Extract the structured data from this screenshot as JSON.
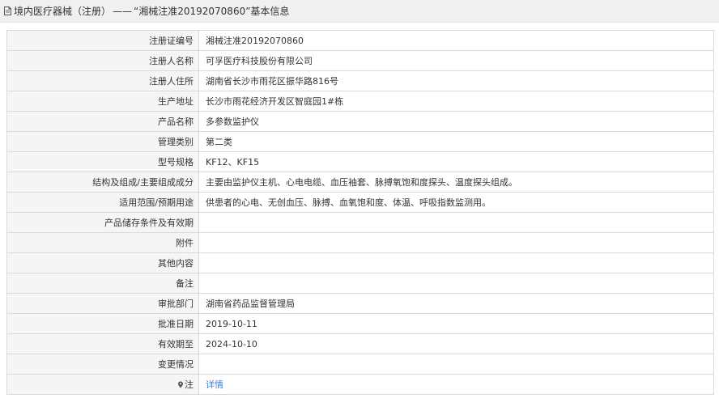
{
  "header": {
    "icon": "document-icon",
    "prefix": "境内医疗器械（注册）",
    "separator": "——",
    "title": "“湘械注准20192070860”基本信息"
  },
  "rows": [
    {
      "label": "注册证编号",
      "value": "湘械注准20192070860"
    },
    {
      "label": "注册人名称",
      "value": "可孚医疗科技股份有限公司"
    },
    {
      "label": "注册人住所",
      "value": "湖南省长沙市雨花区振华路816号"
    },
    {
      "label": "生产地址",
      "value": "长沙市雨花经济开发区智庭园1#栋"
    },
    {
      "label": "产品名称",
      "value": "多参数监护仪"
    },
    {
      "label": "管理类别",
      "value": "第二类"
    },
    {
      "label": "型号规格",
      "value": "KF12、KF15"
    },
    {
      "label": "结构及组成/主要组成成分",
      "value": "主要由监护仪主机、心电电缆、血压袖套、脉搏氧饱和度探头、温度探头组成。"
    },
    {
      "label": "适用范围/预期用途",
      "value": "供患者的心电、无创血压、脉搏、血氧饱和度、体温、呼吸指数监测用。"
    },
    {
      "label": "产品储存条件及有效期",
      "value": ""
    },
    {
      "label": "附件",
      "value": ""
    },
    {
      "label": "其他内容",
      "value": ""
    },
    {
      "label": "备注",
      "value": ""
    },
    {
      "label": "审批部门",
      "value": "湖南省药品监督管理局"
    },
    {
      "label": "批准日期",
      "value": "2019-10-11"
    },
    {
      "label": "有效期至",
      "value": "2024-10-10"
    },
    {
      "label": "变更情况",
      "value": ""
    }
  ],
  "note_row": {
    "icon": "pin-icon",
    "label": "注",
    "link_text": "详情"
  },
  "colors": {
    "label_bg": "#f5f5f5",
    "border": "#d9d9d9",
    "link": "#3a7fd0"
  }
}
